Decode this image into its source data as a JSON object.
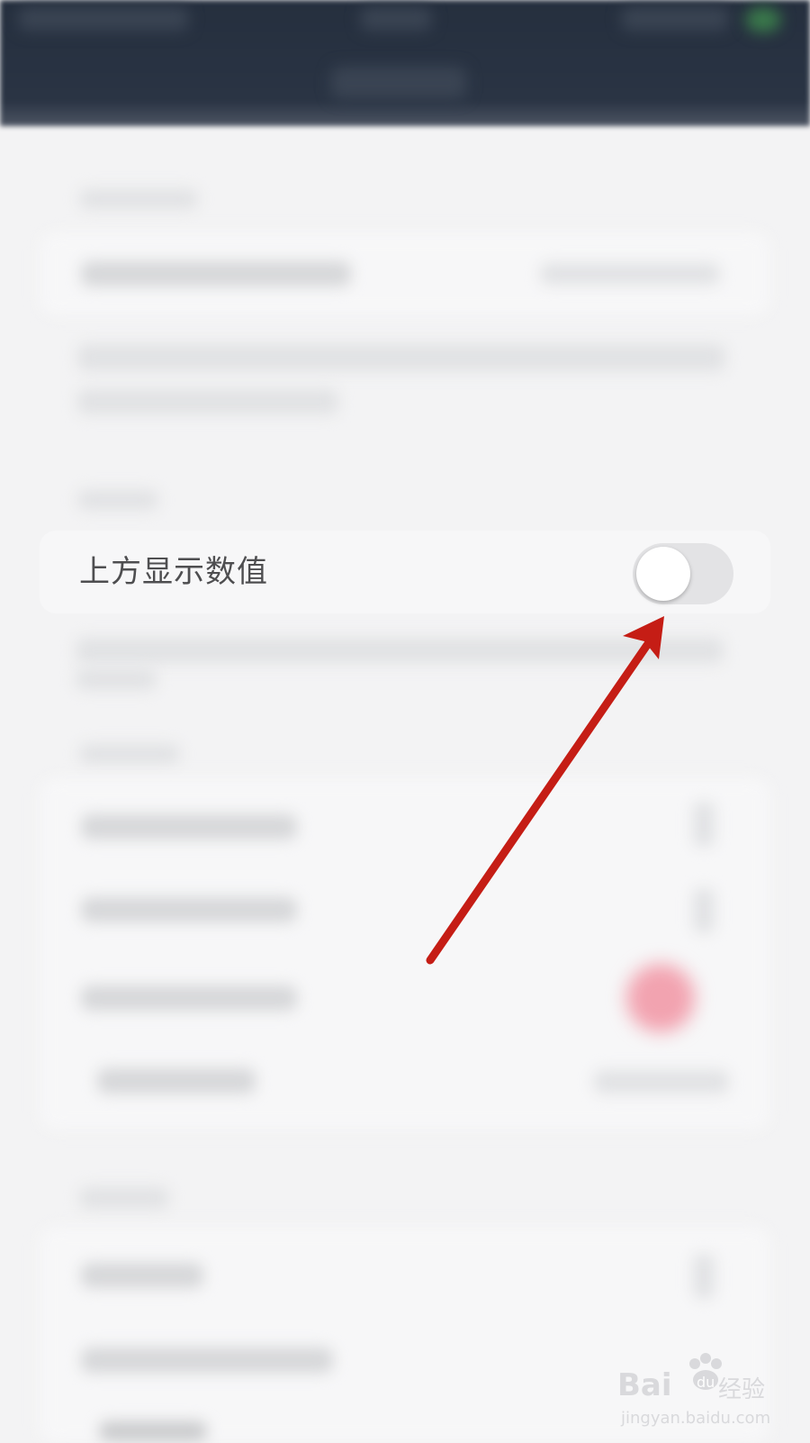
{
  "setting_row": {
    "label": "上方显示数值",
    "toggle_on": false
  },
  "colors": {
    "top_bar": "#252f3e",
    "background": "#f3f3f4",
    "card": "#f7f7f8",
    "toggle_track_off": "#e3e3e5",
    "arrow": "#c51d15"
  },
  "watermark": {
    "brand": "Bai",
    "brand_suffix": "du",
    "cn": "经验",
    "sub": "jingyan.baidu.com"
  }
}
